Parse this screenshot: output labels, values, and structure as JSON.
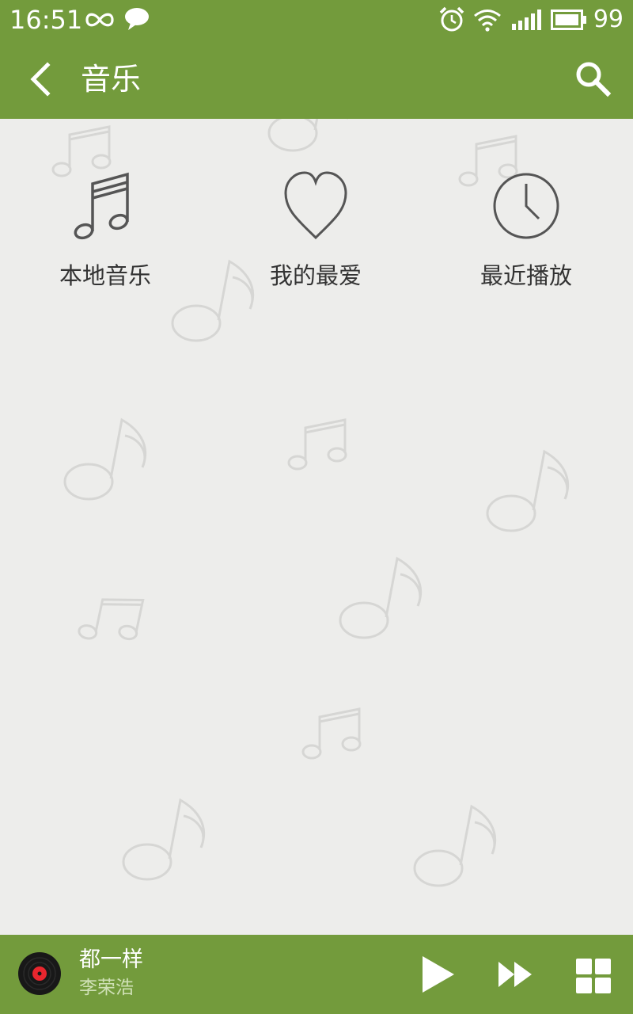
{
  "status_bar": {
    "time": "16:51",
    "battery_level": "99",
    "icons": [
      "infinity-icon",
      "chat-bubble-icon",
      "alarm-clock-icon",
      "wifi-icon",
      "signal-bars-icon",
      "battery-icon"
    ]
  },
  "app_bar": {
    "title": "音乐",
    "icons": [
      "back-arrow-icon",
      "search-icon"
    ]
  },
  "categories": [
    {
      "label": "本地音乐",
      "icon": "music-note-icon"
    },
    {
      "label": "我的最爱",
      "icon": "heart-icon"
    },
    {
      "label": "最近播放",
      "icon": "clock-icon"
    }
  ],
  "now_playing": {
    "title": "都一样",
    "artist": "李荣浩",
    "icons": [
      "vinyl-record-icon",
      "play-icon",
      "fast-forward-icon",
      "grid-menu-icon"
    ]
  },
  "colors": {
    "primary": "#739b3c",
    "background": "#ededeb",
    "icon_gray": "#555555",
    "text_dark": "#333333",
    "artist_text": "#cfe0b6",
    "record_center": "#e8262e"
  }
}
